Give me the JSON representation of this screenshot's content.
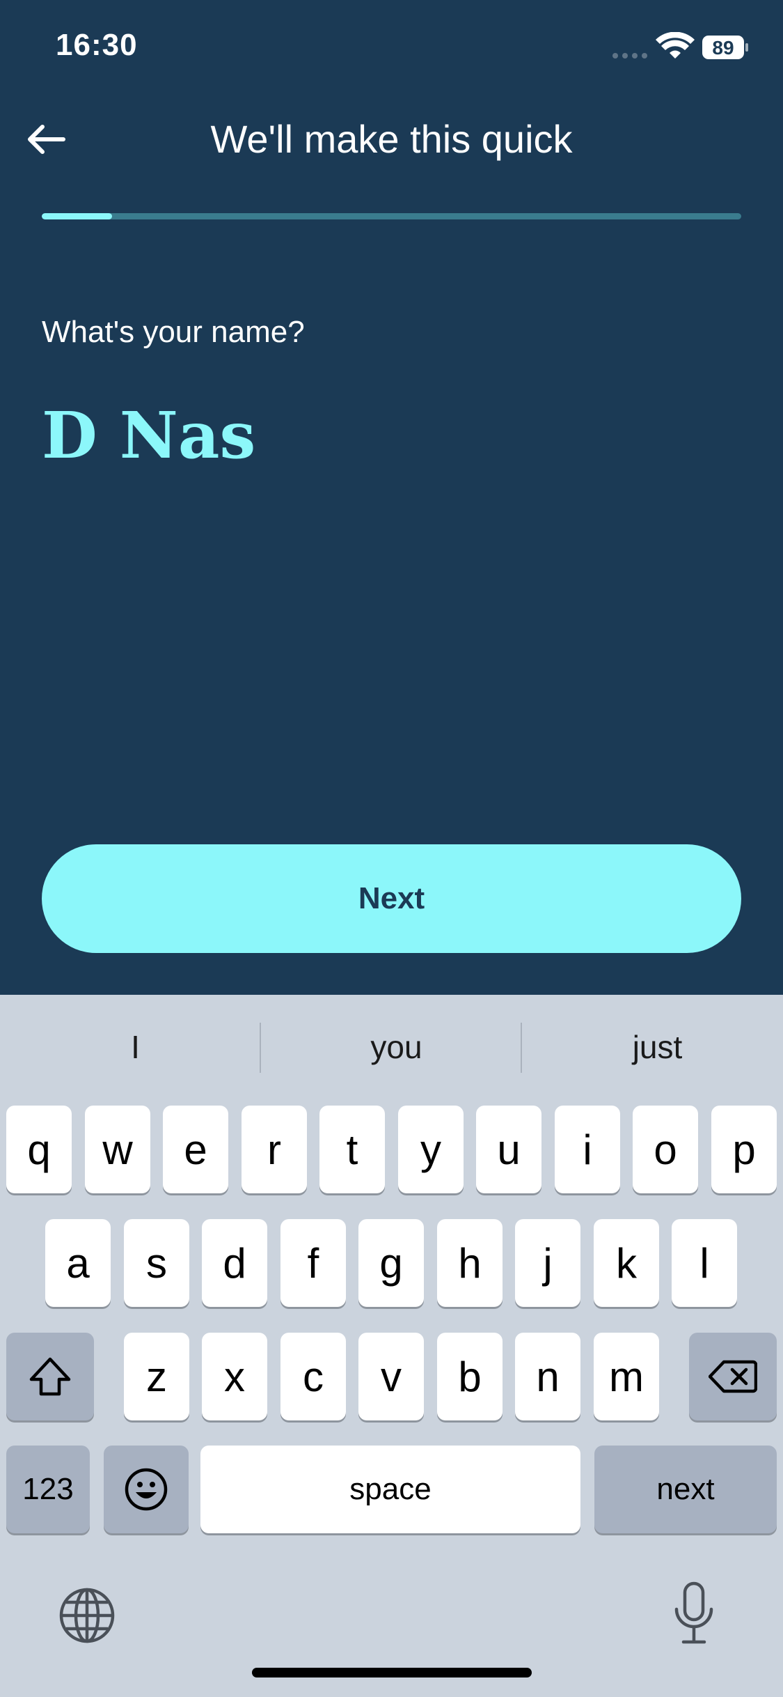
{
  "status_bar": {
    "time": "16:30",
    "battery": "89"
  },
  "header": {
    "title": "We'll make this quick"
  },
  "progress": {
    "fraction": 0.1
  },
  "form": {
    "question": "What's your name?",
    "name_value": "D Nas"
  },
  "actions": {
    "next_label": "Next"
  },
  "keyboard": {
    "suggestions": [
      "I",
      "you",
      "just"
    ],
    "row1": [
      "q",
      "w",
      "e",
      "r",
      "t",
      "y",
      "u",
      "i",
      "o",
      "p"
    ],
    "row2": [
      "a",
      "s",
      "d",
      "f",
      "g",
      "h",
      "j",
      "k",
      "l"
    ],
    "row3": [
      "z",
      "x",
      "c",
      "v",
      "b",
      "n",
      "m"
    ],
    "numbers_label": "123",
    "space_label": "space",
    "return_label": "next"
  },
  "colors": {
    "background": "#1b3a55",
    "accent": "#8cf7fa",
    "progress_track": "#3a7c8e",
    "keyboard_bg": "#cbd3dd",
    "key_light": "#ffffff",
    "key_dark": "#a7b1c1"
  },
  "icons": {
    "back": "arrow-left-icon",
    "shift": "shift-icon",
    "delete": "backspace-icon",
    "emoji": "emoji-icon",
    "globe": "globe-icon",
    "mic": "microphone-icon",
    "wifi": "wifi-icon",
    "battery": "battery-icon"
  }
}
